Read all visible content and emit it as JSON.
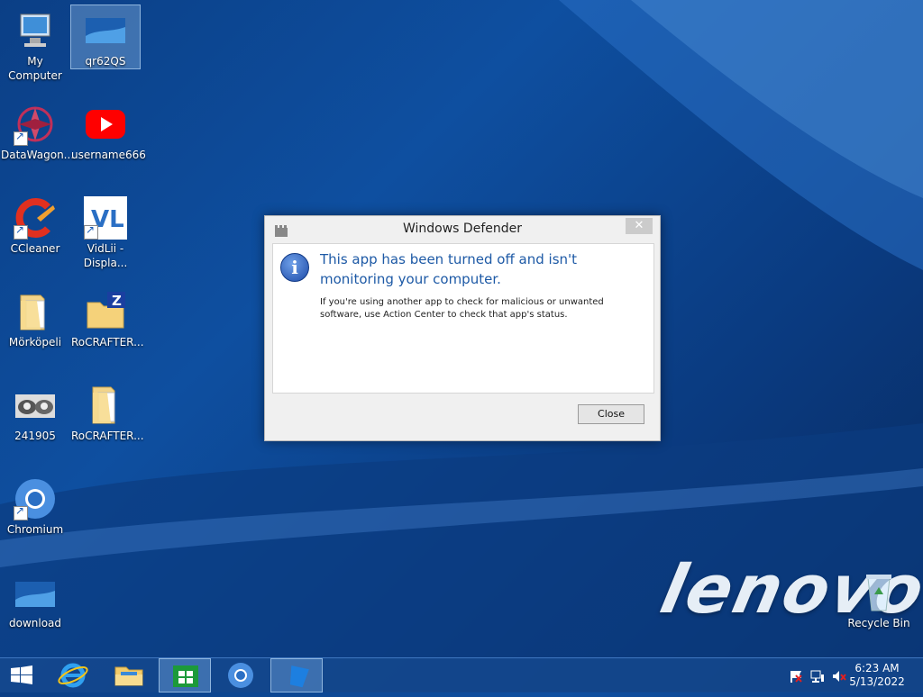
{
  "desktop": {
    "icons": [
      {
        "label": "My Computer"
      },
      {
        "label": "qr62QS"
      },
      {
        "label": "DataWagon..."
      },
      {
        "label": "username666"
      },
      {
        "label": "CCleaner"
      },
      {
        "label": "VidLii - Displa..."
      },
      {
        "label": "Mörköpeli"
      },
      {
        "label": "RoCRAFTER..."
      },
      {
        "label": "241905"
      },
      {
        "label": "RoCRAFTER..."
      },
      {
        "label": "Chromium"
      },
      {
        "label": "download"
      },
      {
        "label": "Recycle Bin"
      }
    ],
    "wallpaper_brand": "lenovo"
  },
  "dialog": {
    "title": "Windows Defender",
    "close_glyph": "✕",
    "main_message": "This app has been turned off and isn't monitoring your computer.",
    "sub_message": "If you're using another app to check for malicious or unwanted software, use Action Center to check that app's status.",
    "button_label": "Close"
  },
  "taskbar": {
    "items": [
      "start-icon",
      "internet-explorer-icon",
      "file-explorer-icon",
      "store-icon",
      "chromium-icon",
      "windows-defender-icon"
    ],
    "clock": {
      "time": "6:23 AM",
      "date": "5/13/2022"
    }
  },
  "colors": {
    "accent": "#1e5aa6",
    "taskbar": "#14468c"
  }
}
